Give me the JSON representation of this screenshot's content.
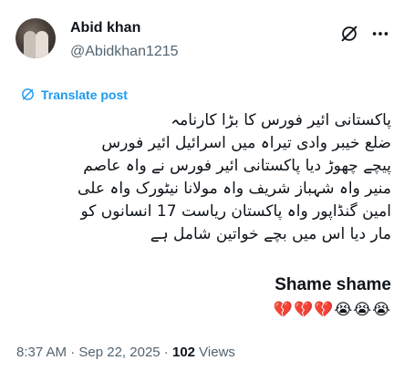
{
  "author": {
    "name": "Abid khan",
    "handle": "@Abidkhan1215"
  },
  "translate_label": "Translate post",
  "tweet_lines": [
    "پاکستانی ائیر فورس کا بڑا کارنامہ",
    "ضلع خیبر وادی تیراہ میں اسرائیل ائیر فورس",
    "پیچے چھوڑ دیا پاکستانی ائیر فورس نے واہ عاصم",
    "منیر واہ شہباز شریف واہ مولانا نیٹورک واہ علی",
    "امین گنڈاپور واہ  پاکستان ریاست 17 انسانوں کو",
    "مار دیا اس میں بچے خواتین شامل ہے"
  ],
  "shame_text": "Shame shame",
  "emojis": "💔💔💔😭😭😭",
  "meta": {
    "time": "8:37 AM",
    "sep1": " · ",
    "date": "Sep 22, 2025",
    "sep2": " · ",
    "views_count": "102",
    "views_label": " Views"
  },
  "icons": {
    "grok": "grok-icon",
    "more": "more-icon",
    "translate": "translate-icon"
  },
  "colors": {
    "link": "#1d9bf0",
    "secondary_text": "#536471",
    "primary_text": "#0f1419"
  }
}
